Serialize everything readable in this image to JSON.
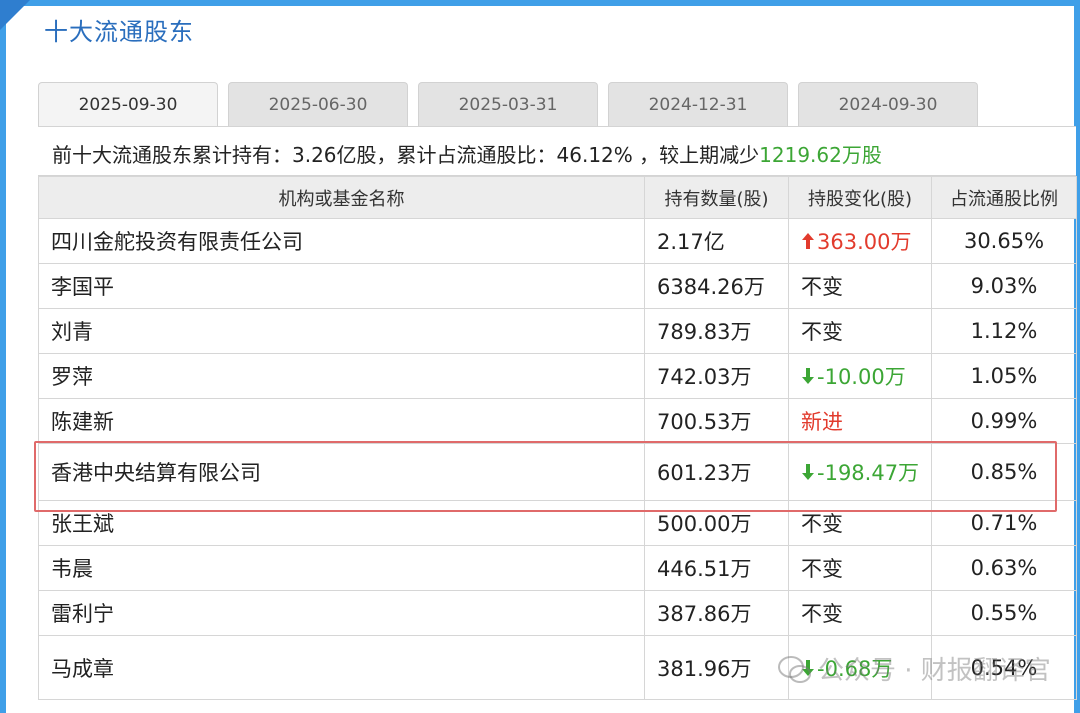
{
  "title": "十大流通股东",
  "tabs": [
    {
      "label": "2025-09-30",
      "active": true
    },
    {
      "label": "2025-06-30",
      "active": false
    },
    {
      "label": "2025-03-31",
      "active": false
    },
    {
      "label": "2024-12-31",
      "active": false
    },
    {
      "label": "2024-09-30",
      "active": false
    }
  ],
  "summary": {
    "prefix": "前十大流通股东累计持有：3.26亿股，累计占流通股比：46.12% ，较上期减少",
    "change": "1219.62万股"
  },
  "table": {
    "headers": [
      "机构或基金名称",
      "持有数量(股)",
      "持股变化(股)",
      "占流通股比例"
    ],
    "rows": [
      {
        "name": "四川金舵投资有限责任公司",
        "shares": "2.17亿",
        "change": "363.00万",
        "change_type": "up",
        "ratio": "30.65%"
      },
      {
        "name": "李国平",
        "shares": "6384.26万",
        "change": "不变",
        "change_type": "same",
        "ratio": "9.03%"
      },
      {
        "name": "刘青",
        "shares": "789.83万",
        "change": "不变",
        "change_type": "same",
        "ratio": "1.12%"
      },
      {
        "name": "罗萍",
        "shares": "742.03万",
        "change": "-10.00万",
        "change_type": "down",
        "ratio": "1.05%"
      },
      {
        "name": "陈建新",
        "shares": "700.53万",
        "change": "新进",
        "change_type": "new",
        "ratio": "0.99%"
      },
      {
        "name": "香港中央结算有限公司",
        "shares": "601.23万",
        "change": "-198.47万",
        "change_type": "down",
        "ratio": "0.85%"
      },
      {
        "name": "张王斌",
        "shares": "500.00万",
        "change": "不变",
        "change_type": "same",
        "ratio": "0.71%"
      },
      {
        "name": "韦晨",
        "shares": "446.51万",
        "change": "不变",
        "change_type": "same",
        "ratio": "0.63%"
      },
      {
        "name": "雷利宁",
        "shares": "387.86万",
        "change": "不变",
        "change_type": "same",
        "ratio": "0.55%"
      },
      {
        "name": "马成章",
        "shares": "381.96万",
        "change": "-0.68万",
        "change_type": "down",
        "ratio": "0.54%"
      }
    ]
  },
  "watermark": "公众号 · 财报翻译官",
  "colors": {
    "accent": "#2a6ebd",
    "up": "#e23b2d",
    "down": "#3ca635",
    "highlight": "#e06a6a"
  }
}
